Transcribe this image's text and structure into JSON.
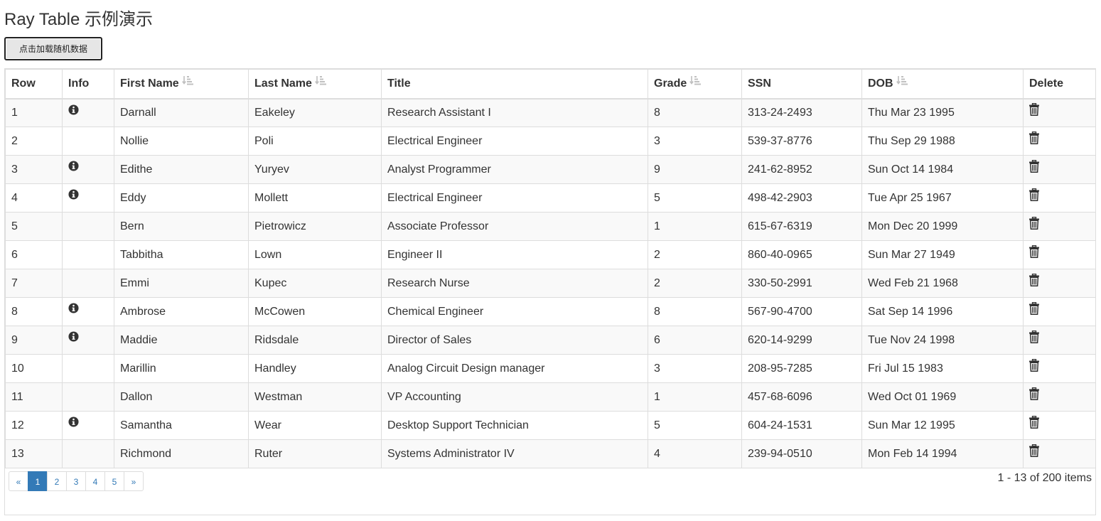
{
  "page": {
    "title": "Ray Table 示例演示",
    "load_button_label": "点击加载随机数据"
  },
  "table": {
    "columns": [
      "Row",
      "Info",
      "First Name",
      "Last Name",
      "Title",
      "Grade",
      "SSN",
      "DOB",
      "Delete"
    ],
    "sortable_columns": [
      "First Name",
      "Last Name",
      "Grade",
      "DOB"
    ],
    "rows": [
      {
        "row": "1",
        "has_info": true,
        "first_name": "Darnall",
        "last_name": "Eakeley",
        "title": "Research Assistant I",
        "grade": "8",
        "ssn": "313-24-2493",
        "dob": "Thu Mar 23 1995"
      },
      {
        "row": "2",
        "has_info": false,
        "first_name": "Nollie",
        "last_name": "Poli",
        "title": "Electrical Engineer",
        "grade": "3",
        "ssn": "539-37-8776",
        "dob": "Thu Sep 29 1988"
      },
      {
        "row": "3",
        "has_info": true,
        "first_name": "Edithe",
        "last_name": "Yuryev",
        "title": "Analyst Programmer",
        "grade": "9",
        "ssn": "241-62-8952",
        "dob": "Sun Oct 14 1984"
      },
      {
        "row": "4",
        "has_info": true,
        "first_name": "Eddy",
        "last_name": "Mollett",
        "title": "Electrical Engineer",
        "grade": "5",
        "ssn": "498-42-2903",
        "dob": "Tue Apr 25 1967"
      },
      {
        "row": "5",
        "has_info": false,
        "first_name": "Bern",
        "last_name": "Pietrowicz",
        "title": "Associate Professor",
        "grade": "1",
        "ssn": "615-67-6319",
        "dob": "Mon Dec 20 1999"
      },
      {
        "row": "6",
        "has_info": false,
        "first_name": "Tabbitha",
        "last_name": "Lown",
        "title": "Engineer II",
        "grade": "2",
        "ssn": "860-40-0965",
        "dob": "Sun Mar 27 1949"
      },
      {
        "row": "7",
        "has_info": false,
        "first_name": "Emmi",
        "last_name": "Kupec",
        "title": "Research Nurse",
        "grade": "2",
        "ssn": "330-50-2991",
        "dob": "Wed Feb 21 1968"
      },
      {
        "row": "8",
        "has_info": true,
        "first_name": "Ambrose",
        "last_name": "McCowen",
        "title": "Chemical Engineer",
        "grade": "8",
        "ssn": "567-90-4700",
        "dob": "Sat Sep 14 1996"
      },
      {
        "row": "9",
        "has_info": true,
        "first_name": "Maddie",
        "last_name": "Ridsdale",
        "title": "Director of Sales",
        "grade": "6",
        "ssn": "620-14-9299",
        "dob": "Tue Nov 24 1998"
      },
      {
        "row": "10",
        "has_info": false,
        "first_name": "Marillin",
        "last_name": "Handley",
        "title": "Analog Circuit Design manager",
        "grade": "3",
        "ssn": "208-95-7285",
        "dob": "Fri Jul 15 1983"
      },
      {
        "row": "11",
        "has_info": false,
        "first_name": "Dallon",
        "last_name": "Westman",
        "title": "VP Accounting",
        "grade": "1",
        "ssn": "457-68-6096",
        "dob": "Wed Oct 01 1969"
      },
      {
        "row": "12",
        "has_info": true,
        "first_name": "Samantha",
        "last_name": "Wear",
        "title": "Desktop Support Technician",
        "grade": "5",
        "ssn": "604-24-1531",
        "dob": "Sun Mar 12 1995"
      },
      {
        "row": "13",
        "has_info": false,
        "first_name": "Richmond",
        "last_name": "Ruter",
        "title": "Systems Administrator IV",
        "grade": "4",
        "ssn": "239-94-0510",
        "dob": "Mon Feb 14 1994"
      }
    ]
  },
  "pagination": {
    "prev_label": "«",
    "next_label": "»",
    "pages": [
      "1",
      "2",
      "3",
      "4",
      "5"
    ],
    "active_page": "1",
    "summary": "1 - 13 of 200 items"
  },
  "icons": {
    "info": "info-circle-icon",
    "delete": "trash-icon",
    "sort": "sort-amount-icon"
  },
  "colors": {
    "link": "#337ab7",
    "active_page_bg": "#337ab7",
    "border": "#dddddd",
    "stripe": "#f9f9f9",
    "text": "#333333",
    "sort_icon": "#c0c0c0"
  }
}
